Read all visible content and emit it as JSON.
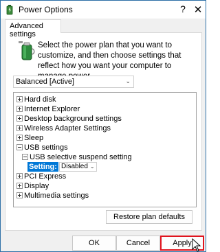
{
  "window": {
    "title": "Power Options",
    "help_label": "?",
    "close_label": "✕"
  },
  "tab": {
    "label": "Advanced settings"
  },
  "description": "Select the power plan that you want to customize, and then choose settings that reflect how you want your computer to manage power.",
  "plan_select": {
    "value": "Balanced [Active]"
  },
  "tree": {
    "items": [
      {
        "label": "Hard disk",
        "state": "collapsed"
      },
      {
        "label": "Internet Explorer",
        "state": "collapsed"
      },
      {
        "label": "Desktop background settings",
        "state": "collapsed"
      },
      {
        "label": "Wireless Adapter Settings",
        "state": "collapsed"
      },
      {
        "label": "Sleep",
        "state": "collapsed"
      },
      {
        "label": "USB settings",
        "state": "expanded"
      },
      {
        "label": "USB selective suspend setting",
        "state": "expanded"
      },
      {
        "label": "PCI Express",
        "state": "collapsed"
      },
      {
        "label": "Display",
        "state": "collapsed"
      },
      {
        "label": "Multimedia settings",
        "state": "collapsed"
      }
    ],
    "setting": {
      "label": "Setting:",
      "value": "Disabled"
    }
  },
  "buttons": {
    "restore": "Restore plan defaults",
    "ok": "OK",
    "cancel": "Cancel",
    "apply": "Apply"
  },
  "colors": {
    "highlight": "#0078d7",
    "apply_outline": "#e0141e",
    "window_border": "#2b6ea6"
  }
}
